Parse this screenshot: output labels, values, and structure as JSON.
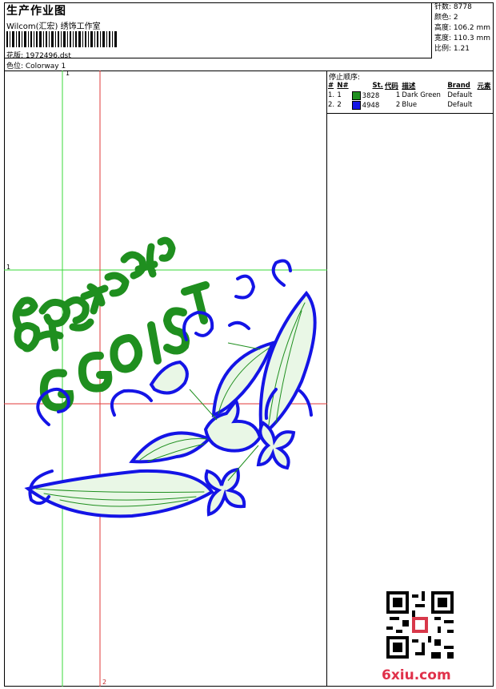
{
  "header": {
    "title": "生产作业图",
    "company": "Wilcom(汇宏) 绣饰工作室",
    "design_label": "花版: 1972496.dst",
    "colorway_label": "色位: Colorway 1"
  },
  "stats": {
    "stitches": "针数: 8778",
    "colors": "颜色: 2",
    "height": "高度: 106.2 mm",
    "width": "宽度: 110.3 mm",
    "ratio": "比例: 1.21"
  },
  "stop_sequence": {
    "heading": "停止顺序:",
    "columns": [
      "#",
      "N#",
      "St.",
      "代码",
      "描述",
      "Brand",
      "元素"
    ],
    "rows": [
      {
        "n": "1.",
        "needle": "1",
        "color": "#1f8f1f",
        "stitches": "3828",
        "code": "1",
        "desc": "Dark Green",
        "brand": "Default"
      },
      {
        "n": "2.",
        "needle": "2",
        "color": "#1414e6",
        "stitches": "4948",
        "code": "2",
        "desc": "Blue",
        "brand": "Default"
      }
    ]
  },
  "design_text": "GGOIST",
  "axis_labels": {
    "v1": "1",
    "h1": "1",
    "v2": "2"
  },
  "watermark": "6xiu.com",
  "colors": {
    "green": "#1f8f1f",
    "blue": "#1414e6",
    "guide_green": "#38d838",
    "guide_red": "#e23a3a"
  }
}
